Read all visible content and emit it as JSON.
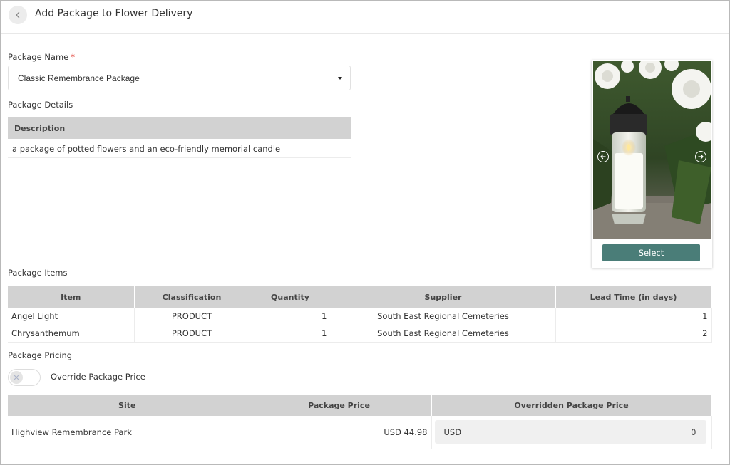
{
  "header": {
    "title": "Add Package to Flower Delivery",
    "back_icon": "chevron-left-icon"
  },
  "package_name": {
    "label": "Package Name",
    "required_mark": "*",
    "selected_value": "Classic Remembrance Package"
  },
  "package_details": {
    "label": "Package Details",
    "column_header": "Description",
    "description": "a package of potted flowers and an eco-friendly memorial candle"
  },
  "image_card": {
    "select_label": "Select",
    "prev_icon": "arrow-left-circle-icon",
    "next_icon": "arrow-right-circle-icon"
  },
  "package_items": {
    "label": "Package Items",
    "columns": [
      "Item",
      "Classification",
      "Quantity",
      "Supplier",
      "Lead Time (in days)"
    ],
    "rows": [
      [
        "Angel Light",
        "PRODUCT",
        "1",
        "South East Regional Cemeteries",
        "1"
      ],
      [
        "Chrysanthemum",
        "PRODUCT",
        "1",
        "South East Regional Cemeteries",
        "2"
      ]
    ]
  },
  "package_pricing": {
    "label": "Package Pricing",
    "override_toggle": {
      "label": "Override Package Price",
      "on": false
    },
    "columns": [
      "Site",
      "Package Price",
      "Overridden Package Price"
    ],
    "rows": [
      {
        "site": "Highview Remembrance Park",
        "price": "USD 44.98",
        "override_currency": "USD",
        "override_value": "0"
      }
    ]
  },
  "colors": {
    "accent": "#4a7d78",
    "table_header": "#d2d2d2",
    "required": "#e0342a"
  }
}
